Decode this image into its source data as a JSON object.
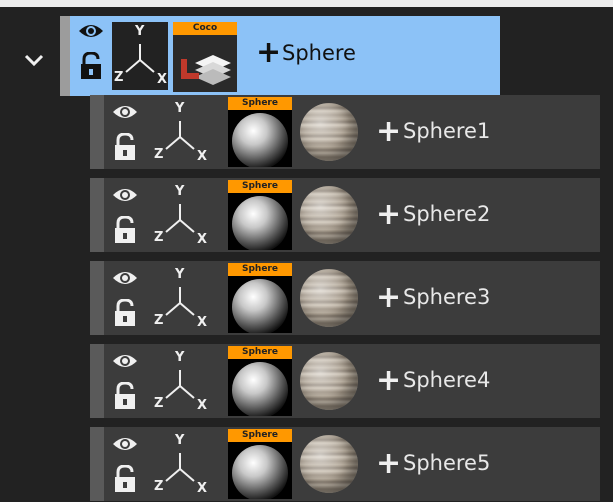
{
  "parent": {
    "thumb_tag": "Coco",
    "label": "Sphere",
    "axes": {
      "x": "X",
      "y": "Y",
      "z": "Z"
    },
    "expanded": true
  },
  "children": [
    {
      "thumb_tag": "Sphere",
      "label": "Sphere1"
    },
    {
      "thumb_tag": "Sphere",
      "label": "Sphere2"
    },
    {
      "thumb_tag": "Sphere",
      "label": "Sphere3"
    },
    {
      "thumb_tag": "Sphere",
      "label": "Sphere4"
    },
    {
      "thumb_tag": "Sphere",
      "label": "Sphere5"
    }
  ],
  "icons": {
    "collapse": "chevron-down-icon",
    "visibility": "eye-icon",
    "lock": "unlock-icon",
    "axes": "axes-icon",
    "add": "plus-icon"
  },
  "colors": {
    "background": "#212121",
    "selected_row": "#8cc2f7",
    "child_row": "#3c3c3c",
    "tag": "#ff9800"
  }
}
